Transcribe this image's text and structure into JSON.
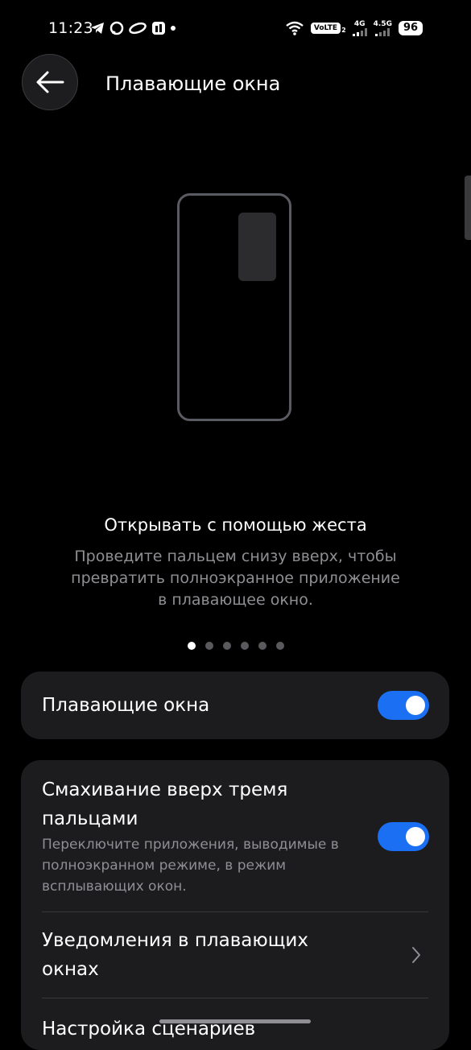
{
  "status_bar": {
    "time": "11:23",
    "volte": "VoLTE",
    "sim2": "2",
    "net1": "4G",
    "net2": "4.5G",
    "battery": "96"
  },
  "header": {
    "title": "Плавающие окна"
  },
  "gesture_info": {
    "title": "Открывать с помощью жеста",
    "description": "Проведите пальцем снизу вверх, чтобы превратить полноэкранное приложение в плавающее окно.",
    "page_count": 6,
    "active_page": 1
  },
  "settings": {
    "floating_windows": {
      "label": "Плавающие окна",
      "enabled": true
    },
    "three_finger_swipe": {
      "label": "Смахивание вверх тремя пальцами",
      "description": "Переключите приложения, выводимые в полноэкранном режиме, в режим всплывающих окон.",
      "enabled": true
    },
    "floating_notifications": {
      "label": "Уведомления в плавающих окнах"
    },
    "scenario_settings": {
      "label": "Настройка сценариев"
    }
  },
  "colors": {
    "accent": "#1a6ff3",
    "card_bg": "#1c1c1e",
    "background": "#000000"
  }
}
